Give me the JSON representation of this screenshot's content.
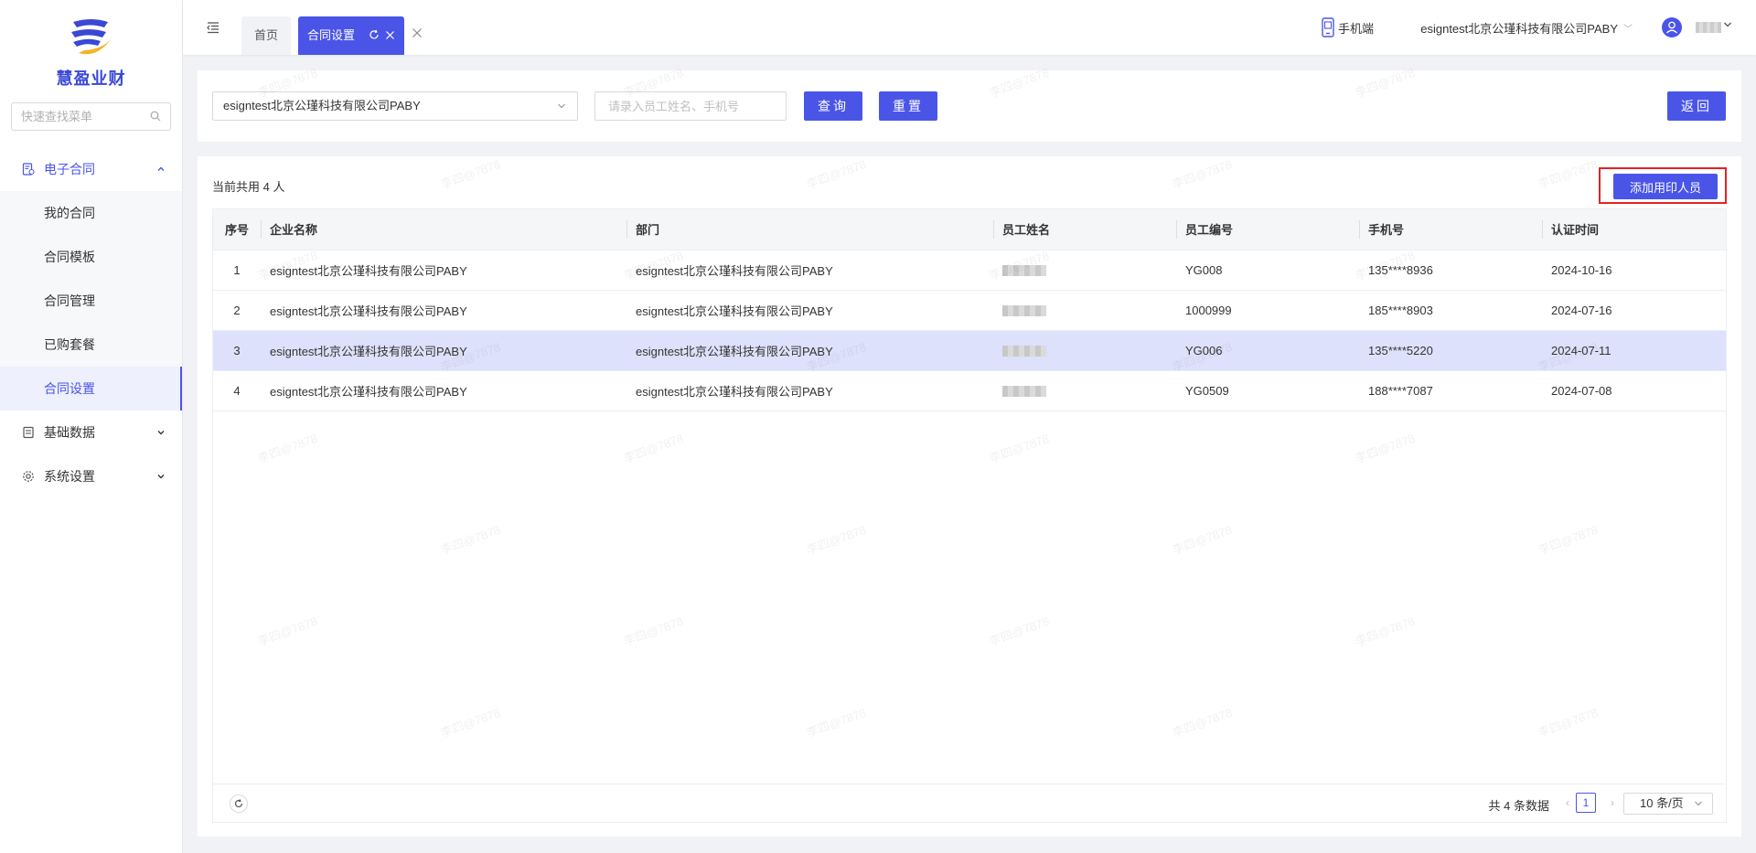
{
  "app": {
    "logo_text": "慧盈业财"
  },
  "sidebar": {
    "search_placeholder": "快速查找菜单",
    "groups": [
      {
        "label": "电子合同",
        "open": true,
        "items": [
          {
            "label": "我的合同"
          },
          {
            "label": "合同模板"
          },
          {
            "label": "合同管理"
          },
          {
            "label": "已购套餐"
          },
          {
            "label": "合同设置",
            "active": true
          }
        ]
      },
      {
        "label": "基础数据",
        "open": false
      },
      {
        "label": "系统设置",
        "open": false
      }
    ]
  },
  "header": {
    "tabs": [
      {
        "label": "首页"
      },
      {
        "label": "合同设置",
        "active": true
      }
    ],
    "mobile_label": "手机端",
    "company": "esigntest北京公瑾科技有限公司PABY"
  },
  "filter": {
    "company_value": "esigntest北京公瑾科技有限公司PABY",
    "employee_placeholder": "请录入员工姓名、手机号",
    "query_label": "查询",
    "reset_label": "重置",
    "back_label": "返回"
  },
  "content": {
    "count_text": "当前共用 4 人",
    "add_label": "添加用印人员"
  },
  "table": {
    "columns": [
      "序号",
      "企业名称",
      "部门",
      "员工姓名",
      "员工编号",
      "手机号",
      "认证时间"
    ],
    "rows": [
      {
        "idx": "1",
        "company": "esigntest北京公瑾科技有限公司PABY",
        "dept": "esigntest北京公瑾科技有限公司PABY",
        "emp_no": "YG008",
        "phone": "135****8936",
        "time": "2024-10-16"
      },
      {
        "idx": "2",
        "company": "esigntest北京公瑾科技有限公司PABY",
        "dept": "esigntest北京公瑾科技有限公司PABY",
        "emp_no": "1000999",
        "phone": "185****8903",
        "time": "2024-07-16"
      },
      {
        "idx": "3",
        "company": "esigntest北京公瑾科技有限公司PABY",
        "dept": "esigntest北京公瑾科技有限公司PABY",
        "emp_no": "YG006",
        "phone": "135****5220",
        "time": "2024-07-11",
        "highlight": true
      },
      {
        "idx": "4",
        "company": "esigntest北京公瑾科技有限公司PABY",
        "dept": "esigntest北京公瑾科技有限公司PABY",
        "emp_no": "YG0509",
        "phone": "188****7087",
        "time": "2024-07-08"
      }
    ]
  },
  "pagination": {
    "total_text": "共 4 条数据",
    "current_page": "1",
    "page_size": "10 条/页"
  },
  "watermark": "李四@7878",
  "colors": {
    "primary": "#4a55e8",
    "highlight_row": "#dde1fb",
    "annotation_box": "#e52222"
  }
}
